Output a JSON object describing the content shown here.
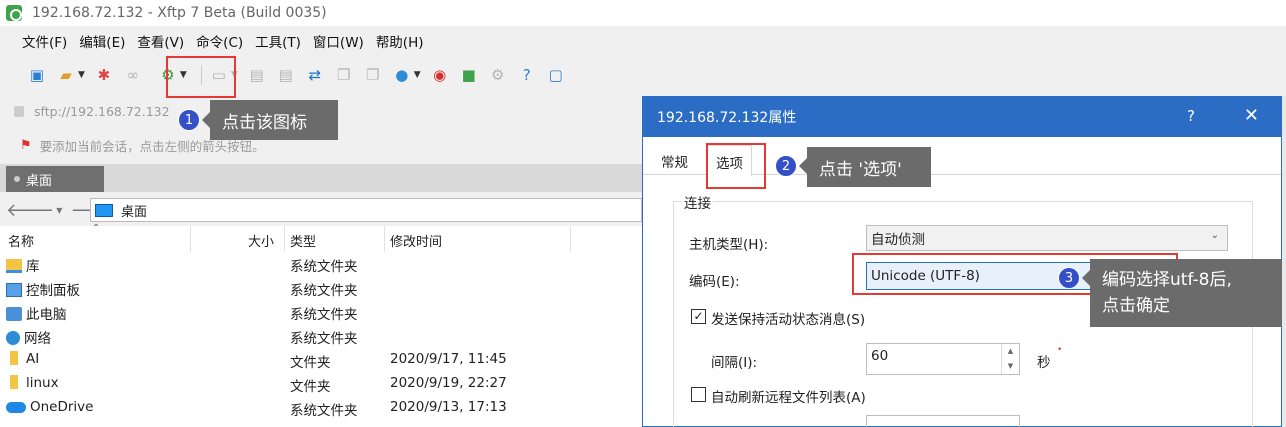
{
  "window": {
    "title": "192.168.72.132 - Xftp 7 Beta (Build 0035)"
  },
  "menu": [
    "文件(F)",
    "编辑(E)",
    "查看(V)",
    "命令(C)",
    "工具(T)",
    "窗口(W)",
    "帮助(H)"
  ],
  "address": {
    "value": "sftp://192.168.72.132"
  },
  "hint": {
    "text": "要添加当前会话，点击左侧的箭头按钮。"
  },
  "left_tab": {
    "label": "桌面"
  },
  "path": {
    "value": "桌面"
  },
  "file_list": {
    "headers": {
      "name": "名称",
      "size": "大小",
      "type": "类型",
      "modified": "修改时间"
    },
    "rows": [
      {
        "name": "库",
        "size": "",
        "type": "系统文件夹",
        "modified": "",
        "icon": "library-icon"
      },
      {
        "name": "控制面板",
        "size": "",
        "type": "系统文件夹",
        "modified": "",
        "icon": "control-panel-icon"
      },
      {
        "name": "此电脑",
        "size": "",
        "type": "系统文件夹",
        "modified": "",
        "icon": "computer-icon"
      },
      {
        "name": "网络",
        "size": "",
        "type": "系统文件夹",
        "modified": "",
        "icon": "network-icon"
      },
      {
        "name": "AI",
        "size": "",
        "type": "文件夹",
        "modified": "2020/9/17, 11:45",
        "icon": "folder-icon"
      },
      {
        "name": "linux",
        "size": "",
        "type": "文件夹",
        "modified": "2020/9/19, 22:27",
        "icon": "folder-icon"
      },
      {
        "name": "OneDrive",
        "size": "",
        "type": "系统文件夹",
        "modified": "2020/9/13, 17:13",
        "icon": "onedrive-icon"
      }
    ]
  },
  "dialog": {
    "title": "192.168.72.132属性",
    "help": "?",
    "close": "✕",
    "tabs": [
      "常规",
      "选项"
    ],
    "group_label": "连接",
    "host_type_label": "主机类型(H):",
    "host_type_value": "自动侦测",
    "encoding_label": "编码(E):",
    "encoding_value": "Unicode (UTF-8)",
    "keepalive_label": "发送保持活动状态消息(S)",
    "keepalive_checked": true,
    "interval_label": "间隔(I):",
    "interval_value": "60",
    "interval_unit": "秒",
    "autorefresh_label": "自动刷新远程文件列表(A)",
    "autorefresh_checked": false
  },
  "callouts": [
    {
      "number": "1",
      "text": "点击该图标"
    },
    {
      "number": "2",
      "text": "点击 '选项'"
    },
    {
      "number": "3",
      "text_line1": "编码选择utf-8后,",
      "text_line2": "点击确定"
    }
  ],
  "colors": {
    "accent": "#2b6cc4",
    "highlight": "#e53935",
    "callout_bg": "#6b6b6b",
    "badge": "#3350c9"
  }
}
